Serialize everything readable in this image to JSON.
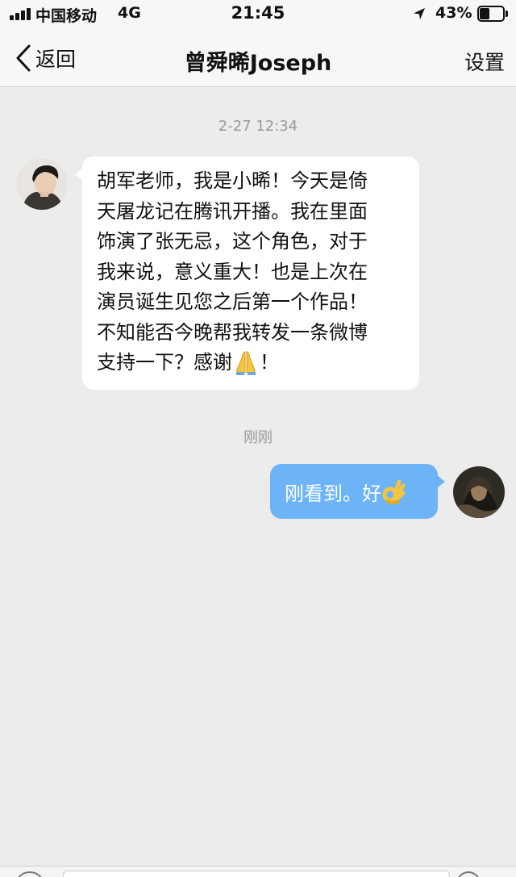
{
  "status_bar": {
    "carrier": "中国移动",
    "network": "4G",
    "time": "21:45",
    "battery_percent_text": "43%",
    "battery_level": 0.43,
    "signal_bars": 4,
    "icons": [
      "signal-icon",
      "location-arrow-icon",
      "battery-icon"
    ]
  },
  "nav": {
    "back_label": "返回",
    "title": "曾舜晞Joseph",
    "settings_label": "设置"
  },
  "chat": {
    "timestamp_1": "2-27 12:34",
    "incoming_message": {
      "lines": [
        "胡军老师，我是小晞！今天是倚",
        "天屠龙记在腾讯开播。我在里面",
        "饰演了张无忌，这个角色，对于",
        "我来说，意义重大！也是上次在",
        "演员诞生见您之后第一个作品！",
        "不知能否今晚帮我转发一条微博",
        "支持一下？感谢"
      ],
      "last_line_suffix": "！",
      "emoji": "folded-hands-emoji"
    },
    "timestamp_2": "刚刚",
    "outgoing_message": {
      "text": "刚看到。好",
      "emoji": "ok-hand-emoji"
    }
  },
  "colors": {
    "background": "#ececec",
    "bar_background": "#f7f7f7",
    "incoming_bubble": "#ffffff",
    "outgoing_bubble": "#6cb4f7",
    "timestamp_text": "#9a9a9a"
  }
}
